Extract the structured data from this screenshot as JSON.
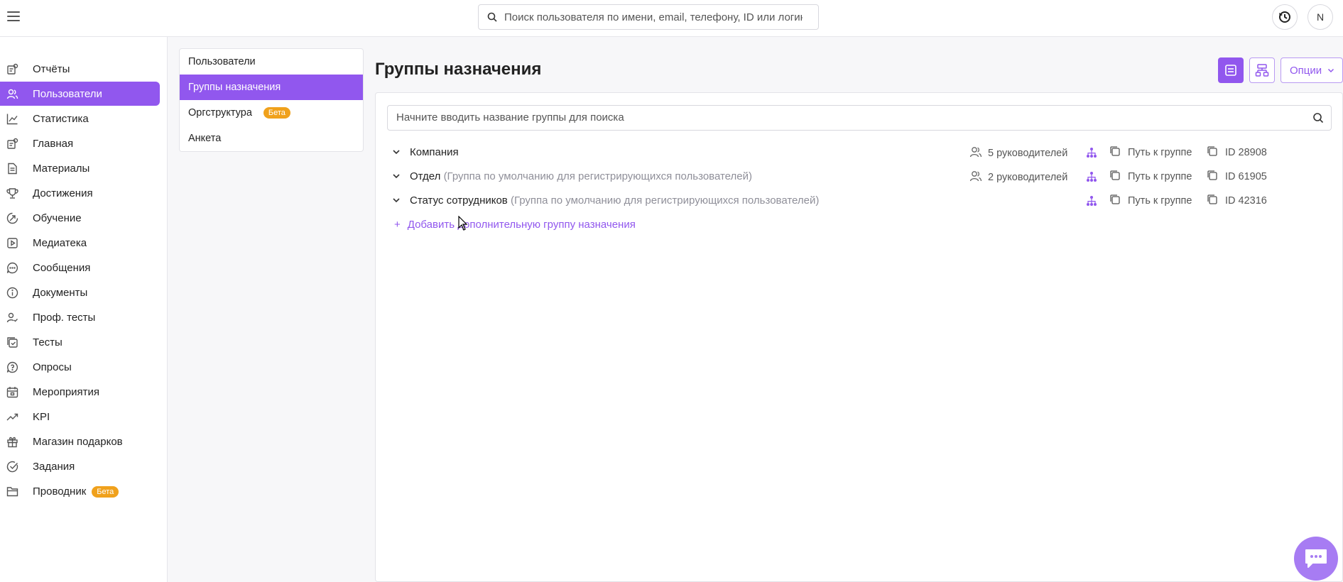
{
  "topbar": {
    "search_placeholder": "Поиск пользователя по имени, email, телефону, ID или логину",
    "avatar_letter": "N"
  },
  "sidebar": {
    "items": [
      {
        "label": "Отчёты",
        "icon": "reports-icon"
      },
      {
        "label": "Пользователи",
        "icon": "users-icon",
        "active": true
      },
      {
        "label": "Статистика",
        "icon": "stats-icon"
      },
      {
        "label": "Главная",
        "icon": "home-icon"
      },
      {
        "label": "Материалы",
        "icon": "document-icon"
      },
      {
        "label": "Достижения",
        "icon": "trophy-icon"
      },
      {
        "label": "Обучение",
        "icon": "learning-icon"
      },
      {
        "label": "Медиатека",
        "icon": "media-icon"
      },
      {
        "label": "Сообщения",
        "icon": "message-icon"
      },
      {
        "label": "Документы",
        "icon": "info-icon"
      },
      {
        "label": "Проф. тесты",
        "icon": "user-check-icon"
      },
      {
        "label": "Тесты",
        "icon": "tests-icon"
      },
      {
        "label": "Опросы",
        "icon": "survey-icon"
      },
      {
        "label": "Мероприятия",
        "icon": "calendar-icon"
      },
      {
        "label": "KPI",
        "icon": "trend-icon"
      },
      {
        "label": "Магазин подарков",
        "icon": "gift-icon"
      },
      {
        "label": "Задания",
        "icon": "task-icon"
      },
      {
        "label": "Проводник",
        "icon": "folder-icon",
        "badge": "Бета"
      }
    ]
  },
  "subnav": {
    "items": [
      {
        "label": "Пользователи"
      },
      {
        "label": "Группы назначения",
        "active": true
      },
      {
        "label": "Оргструктура",
        "badge": "Бета"
      },
      {
        "label": "Анкета"
      }
    ]
  },
  "main": {
    "title": "Группы назначения",
    "options_label": "Опции",
    "group_search_placeholder": "Начните вводить название группы для поиска",
    "groups": [
      {
        "name": "Компания",
        "hint": "",
        "managers": "5 руководителей",
        "path": "Путь к группе",
        "id": "ID 28908"
      },
      {
        "name": "Отдел",
        "hint": "(Группа по умолчанию для регистрирующихся пользователей)",
        "managers": "2 руководителей",
        "path": "Путь к группе",
        "id": "ID 61905"
      },
      {
        "name": "Статус сотрудников",
        "hint": "(Группа по умолчанию для регистрирующихся пользователей)",
        "managers": "",
        "path": "Путь к группе",
        "id": "ID 42316"
      }
    ],
    "add_group_label": "Добавить дополнительную группу назначения"
  },
  "colors": {
    "accent": "#9157ee",
    "badge": "#f0a11c"
  }
}
